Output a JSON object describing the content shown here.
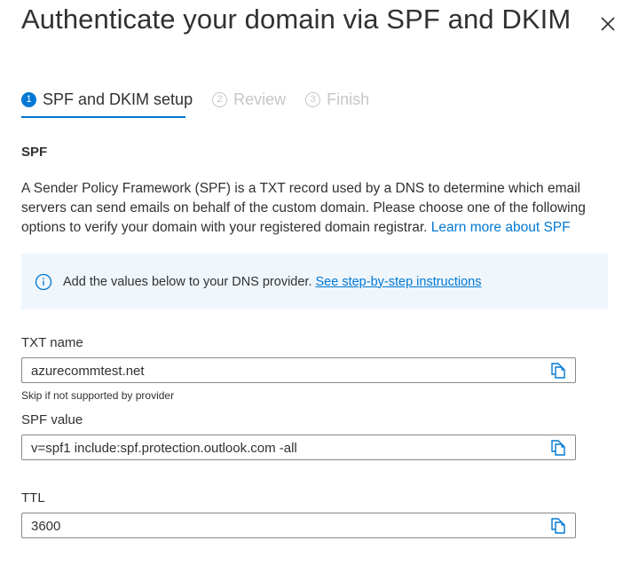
{
  "dialog": {
    "title": "Authenticate your domain via SPF and DKIM",
    "close_icon": "close-icon"
  },
  "steps": [
    {
      "number": "1",
      "label": "SPF and DKIM setup",
      "state": "active"
    },
    {
      "number": "2",
      "label": "Review",
      "state": "inactive"
    },
    {
      "number": "3",
      "label": "Finish",
      "state": "inactive"
    }
  ],
  "spf": {
    "heading": "SPF",
    "description": "A Sender Policy Framework (SPF) is a TXT record used by a DNS to determine which email servers can send emails on behalf of the custom domain. Please choose one of the following options to verify your domain with your registered domain registrar.",
    "learn_more_link": "Learn more about SPF",
    "info": {
      "icon": "info-icon",
      "text": "Add the values below to your DNS provider.",
      "link": "See step-by-step instructions"
    },
    "fields": {
      "txt_name": {
        "label": "TXT name",
        "value": "azurecommtest.net",
        "hint": "Skip if not supported by provider"
      },
      "spf_value": {
        "label": "SPF value",
        "value": "v=spf1 include:spf.protection.outlook.com -all"
      },
      "ttl": {
        "label": "TTL",
        "value": "3600"
      }
    },
    "copy_icon": "copy-icon"
  },
  "colors": {
    "accent": "#0078d4",
    "info_background": "#eff6fc",
    "text": "#323130",
    "disabled": "#c8c6c4",
    "border": "#8a8886"
  }
}
